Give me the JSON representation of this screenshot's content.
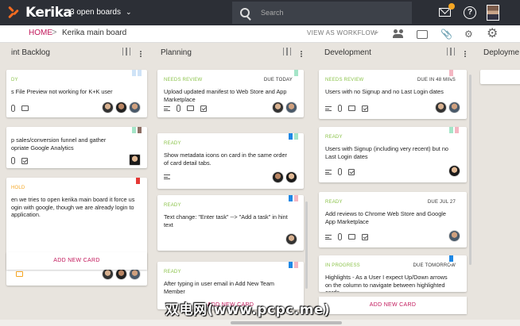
{
  "topbar": {
    "app_name": "Kerika",
    "boards_dropdown": "3 open boards",
    "search_placeholder": "Search",
    "help_label": "?"
  },
  "subbar": {
    "home": "HOME",
    "separator": ">",
    "board_name": "Kerika main board",
    "view_as": "VIEW AS WORKFLOW",
    "view_chevron": "⌄"
  },
  "columns": [
    {
      "name": "int Backlog",
      "cards": [
        {
          "status": "DY",
          "due": "",
          "title": "s File Preview not working for K+K user"
        },
        {
          "status": "",
          "due": "",
          "title": "p sales/conversion funnel and gather\nopriate Google Analytics"
        },
        {
          "status": "HOLD",
          "due": "",
          "title": "en we tries to open kerika main board it force us\nogin with google, though we are already login to\napplication."
        }
      ],
      "add_card": "ADD NEW CARD"
    },
    {
      "name": "Planning",
      "cards": [
        {
          "status": "NEEDS REVIEW",
          "due": "DUE TODAY",
          "title": "Upload updated manifest to Web Store and App\nMarketplace"
        },
        {
          "status": "READY",
          "due": "",
          "title": "Show metadata icons on card in the same order\nof card detail tabs."
        },
        {
          "status": "READY",
          "due": "",
          "title": "Text change: \"Enter task\" --> \"Add a task\" in hint\ntext"
        },
        {
          "status": "READY",
          "due": "",
          "title": "After typing in user email in Add New Team\nMember"
        }
      ],
      "add_card": "ADD NEW CARD"
    },
    {
      "name": "Development",
      "cards": [
        {
          "status": "NEEDS REVIEW",
          "due": "DUE IN 48 MINS",
          "title": "Users with no Signup and no Last Login dates"
        },
        {
          "status": "READY",
          "due": "",
          "title": "Users with Signup (including very recent) but no\nLast Login dates"
        },
        {
          "status": "READY",
          "due": "DUE JUL 27",
          "title": "Add reviews to Chrome Web Store and Google\nApp Marketplace"
        },
        {
          "status": "IN PROGRESS",
          "due": "DUE TOMORROW",
          "title": "Highlights - As a User I expect Up/Down arrows\non the column to navigate between highlighted\ncards"
        }
      ],
      "add_card": "ADD NEW CARD"
    },
    {
      "name": "Deployme",
      "cards": []
    }
  ],
  "watermark": "双电网(www.pcpc.me)",
  "colors": {
    "topbar": "#2c2f36",
    "accent": "#c2185b",
    "ready": "#8bc34a",
    "hold": "#f5a623",
    "flag_blue": "#1e88e5",
    "flag_red": "#e53935",
    "flag_mint": "#a5e5c8",
    "flag_pink": "#f4b6c2",
    "flag_brown": "#8d6e63",
    "flag_lightblue": "#cfe3f7"
  }
}
